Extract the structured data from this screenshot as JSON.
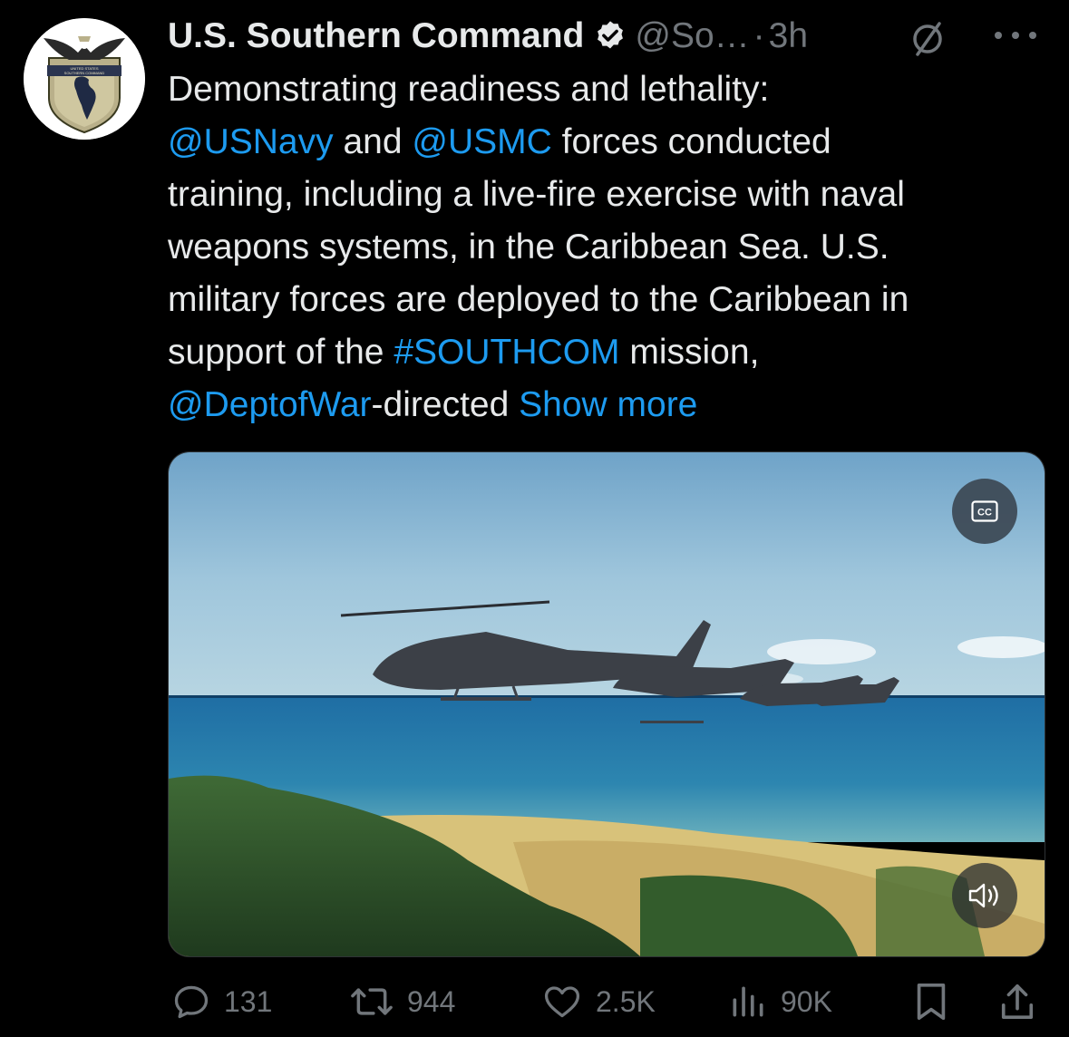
{
  "post": {
    "author_name": "U.S. Southern Command",
    "handle": "@So…",
    "separator": "·",
    "time": "3h",
    "lines": [
      [
        {
          "t": "Demonstrating readiness and lethality:",
          "link": false
        }
      ],
      [
        {
          "t": "@USNavy",
          "link": true
        },
        {
          "t": " and ",
          "link": false
        },
        {
          "t": "@USMC",
          "link": true
        },
        {
          "t": " forces conducted",
          "link": false
        }
      ],
      [
        {
          "t": "training, including a live-fire exercise with naval",
          "link": false
        }
      ],
      [
        {
          "t": "weapons systems, in the Caribbean Sea. U.S.",
          "link": false
        }
      ],
      [
        {
          "t": "military forces are deployed to the Caribbean in",
          "link": false
        }
      ],
      [
        {
          "t": "support of the ",
          "link": false
        },
        {
          "t": "#SOUTHCOM",
          "link": true
        },
        {
          "t": " mission,",
          "link": false
        }
      ],
      [
        {
          "t": "@DeptofWar",
          "link": true
        },
        {
          "t": "-directed ",
          "link": false
        },
        {
          "t": "Show more",
          "link": true
        }
      ]
    ],
    "avatar_text": "UNITED STATES SOUTHERN COMMAND"
  },
  "media": {
    "cc_label": "CC",
    "volume_icon": "speaker-icon"
  },
  "actions": {
    "replies": "131",
    "reposts": "944",
    "likes": "2.5K",
    "views": "90K"
  },
  "colors": {
    "link": "#1d9bf0",
    "muted": "#71767b",
    "text": "#e7e9ea"
  }
}
